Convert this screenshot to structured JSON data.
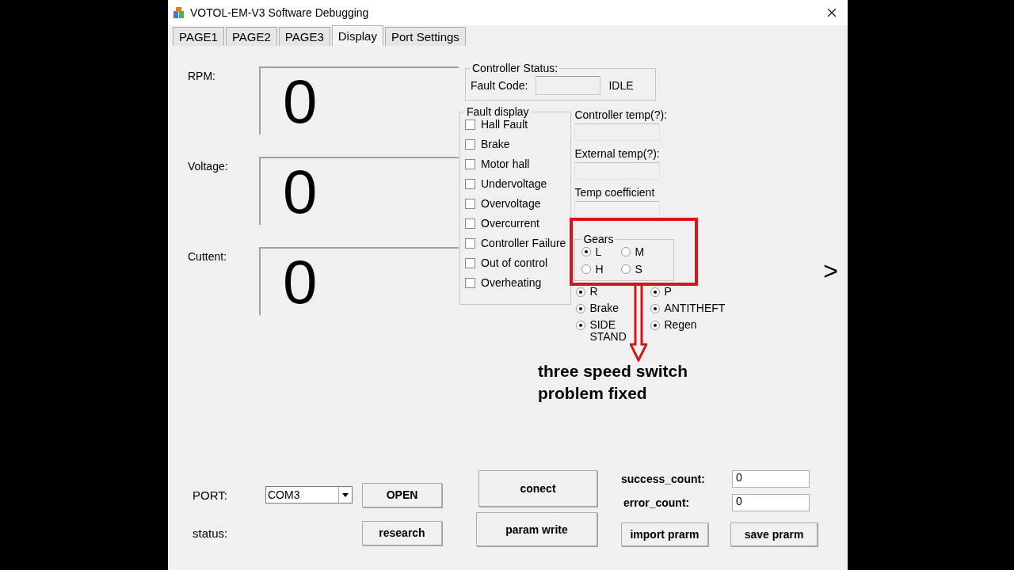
{
  "window": {
    "title": "VOTOL-EM-V3 Software Debugging"
  },
  "tabs": [
    {
      "label": "PAGE1",
      "selected": false
    },
    {
      "label": "PAGE2",
      "selected": false
    },
    {
      "label": "PAGE3",
      "selected": false
    },
    {
      "label": "Display",
      "selected": true
    },
    {
      "label": "Port Settings",
      "selected": false
    }
  ],
  "readouts": [
    {
      "label": "RPM:",
      "value": "0"
    },
    {
      "label": "Voltage:",
      "value": "0"
    },
    {
      "label": "Cuttent:",
      "value": "0"
    }
  ],
  "controller_status": {
    "title": "Controller Status:",
    "fault_code_label": "Fault Code:",
    "state": "IDLE"
  },
  "fault_display": {
    "title": "Fault display",
    "items": [
      {
        "label": "Hall Fault",
        "checked": false
      },
      {
        "label": "Brake",
        "checked": false
      },
      {
        "label": "Motor hall",
        "checked": false
      },
      {
        "label": "Undervoltage",
        "checked": false
      },
      {
        "label": "Overvoltage",
        "checked": false
      },
      {
        "label": "Overcurrent",
        "checked": false
      },
      {
        "label": "Controller Failure",
        "checked": false
      },
      {
        "label": "Out of control",
        "checked": false
      },
      {
        "label": "Overheating",
        "checked": false
      }
    ]
  },
  "temps": [
    {
      "label": "Controller temp(?):"
    },
    {
      "label": "External temp(?):"
    },
    {
      "label": "Temp coefficient"
    }
  ],
  "gears": {
    "title": "Gears",
    "options": [
      {
        "label": "L",
        "selected": true
      },
      {
        "label": "M",
        "selected": false
      },
      {
        "label": "H",
        "selected": false
      },
      {
        "label": "S",
        "selected": false
      }
    ]
  },
  "indicators": [
    {
      "label": "R",
      "on": true
    },
    {
      "label": "P",
      "on": true
    },
    {
      "label": "Brake",
      "on": true
    },
    {
      "label": "ANTITHEFT",
      "on": true
    },
    {
      "label": "SIDE STAND",
      "on": true
    },
    {
      "label": "Regen",
      "on": true
    }
  ],
  "annotation": {
    "text": "three speed switch problem fixed"
  },
  "next_arrow": ">",
  "connection": {
    "port_label": "PORT:",
    "port": "COM3",
    "open": "OPEN",
    "status_label": "status:",
    "research": "research"
  },
  "actions": [
    "conect",
    "param write"
  ],
  "counters": [
    {
      "label": "success_count:",
      "value": "0"
    },
    {
      "label": "error_count:",
      "value": "0"
    }
  ],
  "file_buttons": [
    "import prarm",
    "save prarm"
  ]
}
